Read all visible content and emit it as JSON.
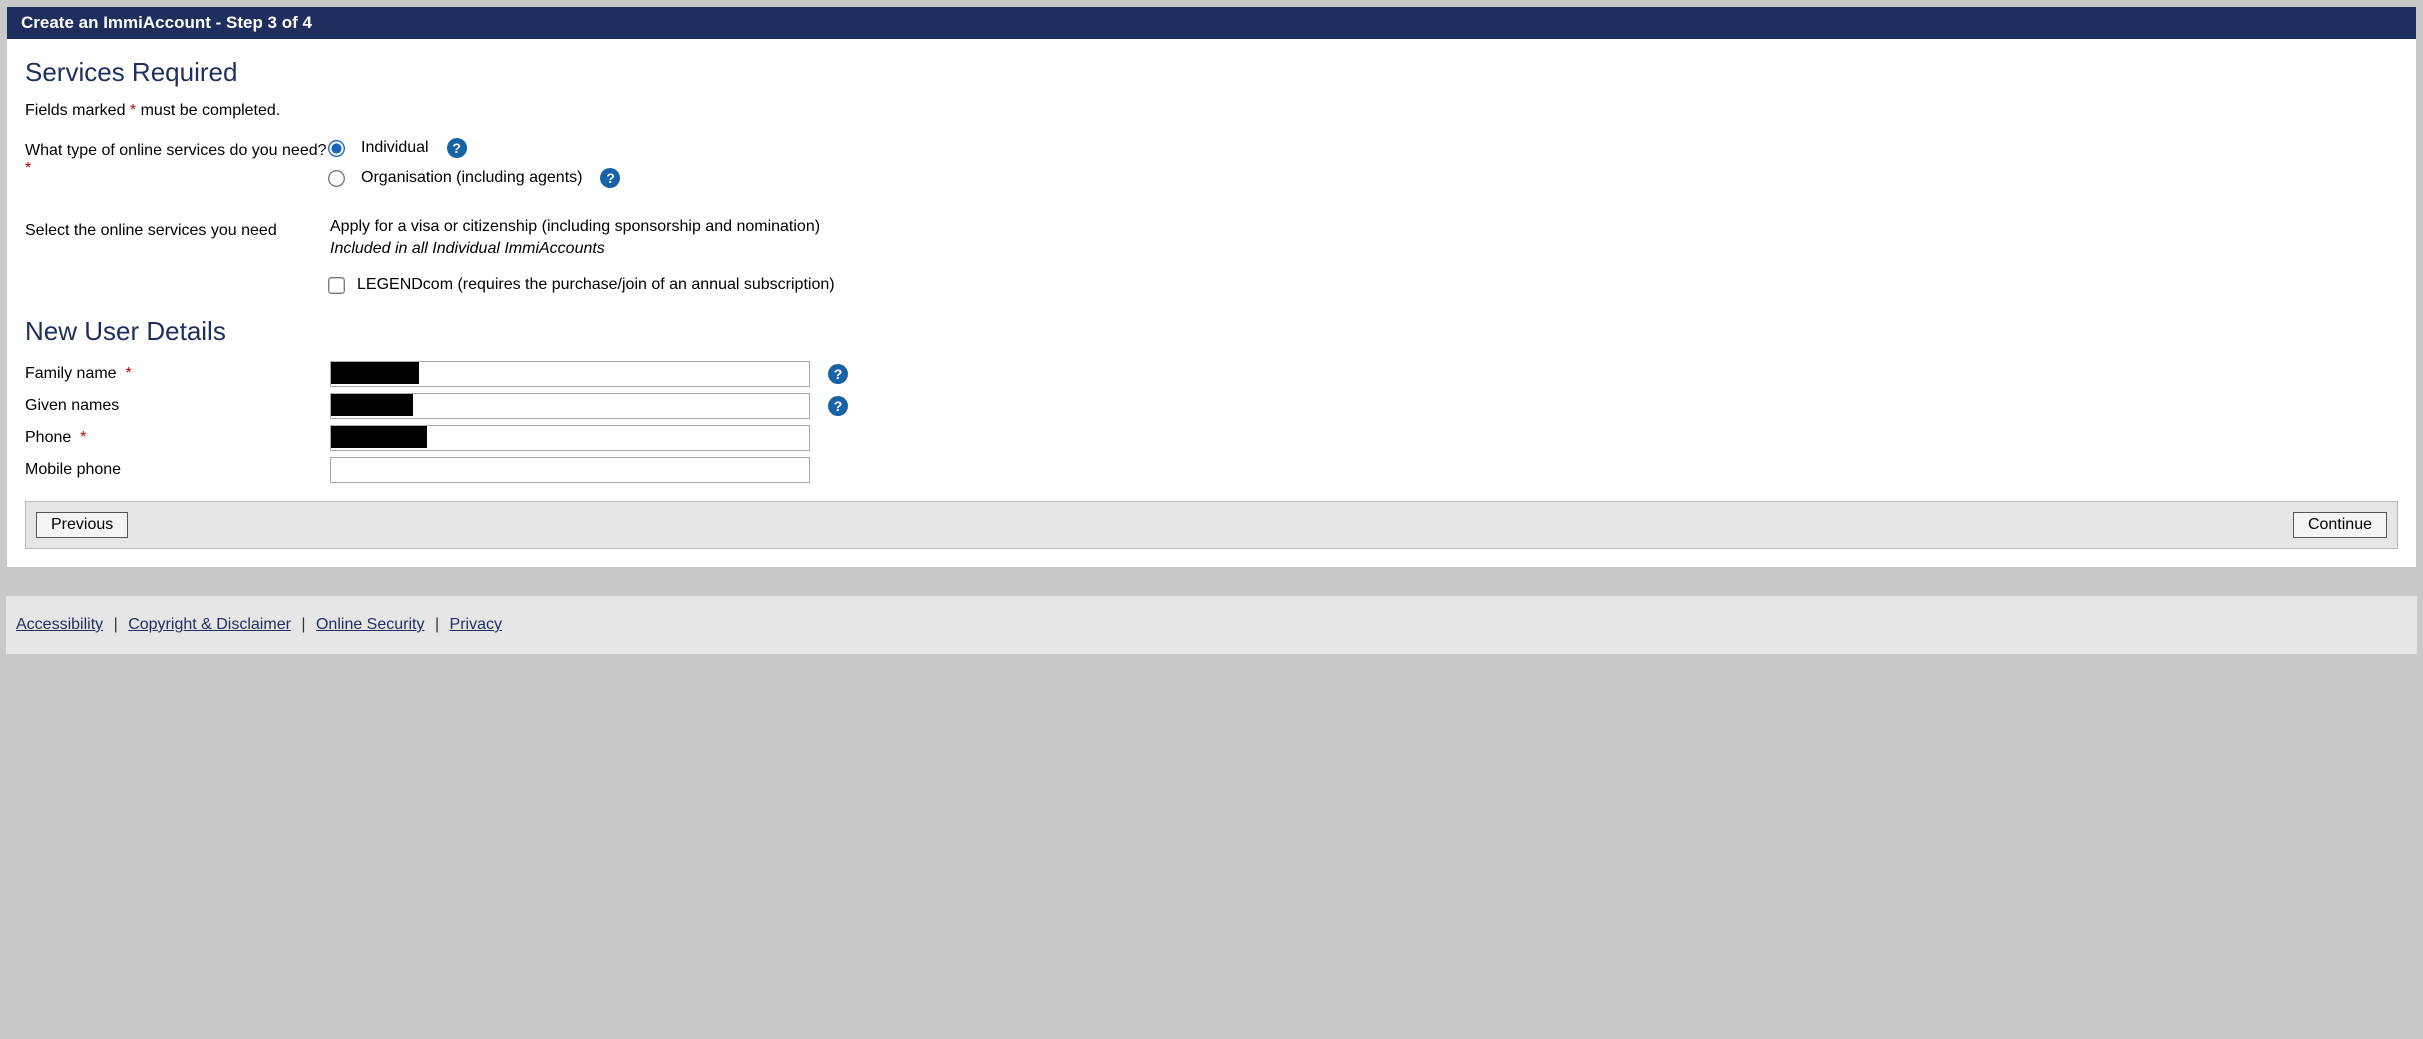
{
  "header": {
    "title": "Create an ImmiAccount - Step 3 of 4"
  },
  "services": {
    "heading": "Services Required",
    "hint_prefix": "Fields marked ",
    "hint_marker": "*",
    "hint_suffix": " must be completed.",
    "question": "What type of online services do you need?",
    "options": {
      "individual": "Individual",
      "organisation": "Organisation (including agents)"
    },
    "select_label": "Select the online services you need",
    "visa_line": "Apply for a visa or citizenship (including sponsorship and nomination)",
    "visa_note": "Included in all Individual ImmiAccounts",
    "legendcom": "LEGENDcom (requires the purchase/join of an annual subscription)"
  },
  "user": {
    "heading": "New User Details",
    "family_label": "Family name",
    "given_label": "Given names",
    "phone_label": "Phone",
    "mobile_label": "Mobile phone",
    "family_value": "",
    "given_value": "",
    "phone_value": "",
    "mobile_value": ""
  },
  "buttons": {
    "previous": "Previous",
    "continue": "Continue"
  },
  "footer": {
    "accessibility": "Accessibility",
    "copyright": "Copyright & Disclaimer",
    "security": "Online Security",
    "privacy": "Privacy"
  }
}
